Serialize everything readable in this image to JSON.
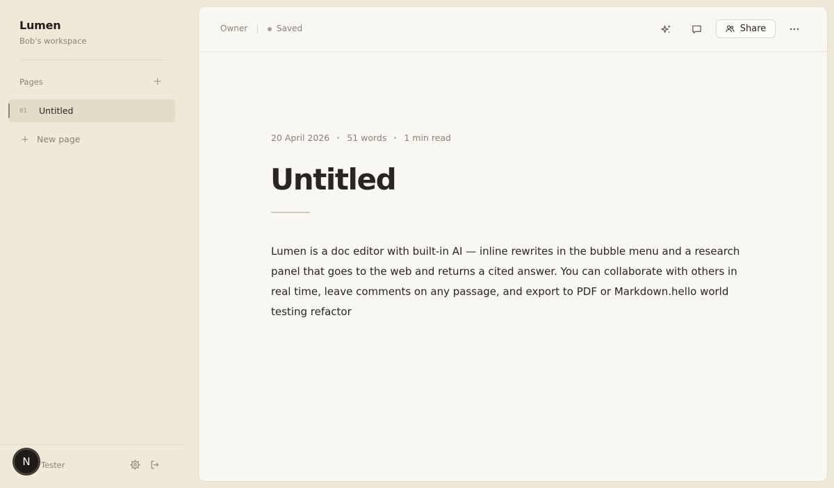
{
  "sidebar": {
    "brand": "Lumen",
    "workspace": "Bob's workspace",
    "pages_label": "Pages",
    "pages": [
      {
        "num": "01",
        "title": "Untitled"
      }
    ],
    "new_page_label": "New page",
    "user": {
      "initial": "N",
      "name": "Tester"
    }
  },
  "topbar": {
    "role": "Owner",
    "status": "Saved",
    "share_label": "Share"
  },
  "doc": {
    "date": "20 April 2026",
    "words": "51 words",
    "read_time": "1 min read",
    "title": "Untitled",
    "body": "Lumen is a doc editor with built-in AI — inline rewrites in the bubble menu and a research panel that goes to the web and returns a cited answer. You can collaborate with others in real time, leave comments on any passage, and export to PDF or Markdown.hello world testing refactor"
  },
  "colors": {
    "background": "#efe9da",
    "panel": "#f9f7f2",
    "text": "#2a2520",
    "muted": "#8a8275",
    "active_item": "#e3dcc9"
  },
  "icons": [
    "add-icon",
    "plus-icon",
    "settings-icon",
    "logout-icon",
    "sparkle-icon",
    "comment-icon",
    "users-icon",
    "more-icon"
  ]
}
